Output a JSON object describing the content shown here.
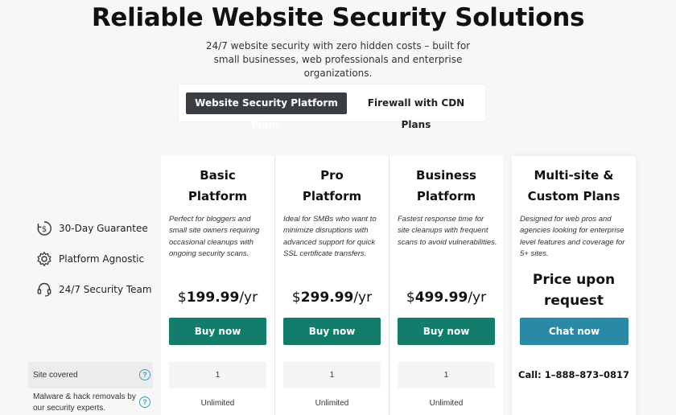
{
  "header": {
    "title": "Reliable Website Security Solutions",
    "subtitle": "24/7 website security with zero hidden costs – built for small businesses, web professionals and enterprise organizations."
  },
  "tabs": [
    {
      "label": "Website Security Platform Plans",
      "active": true
    },
    {
      "label": "Firewall with CDN Plans",
      "active": false
    }
  ],
  "features": [
    {
      "icon": "dollar-refresh-icon",
      "label": "30-Day Guarantee"
    },
    {
      "icon": "gear-icon",
      "label": "Platform Agnostic"
    },
    {
      "icon": "headset-icon",
      "label": "24/7 Security Team"
    }
  ],
  "plans": [
    {
      "name_line1": "Basic",
      "name_line2": "Platform",
      "description": "Perfect for bloggers and small site owners requiring occasional cleanups with ongoing security scans.",
      "price_currency": "$",
      "price_amount": "199.99",
      "price_period": "/yr",
      "button_label": "Buy now",
      "sites_covered": "1",
      "malware_removals": "Unlimited"
    },
    {
      "name_line1": "Pro",
      "name_line2": "Platform",
      "description": "Ideal for SMBs who want to minimize disruptions with advanced support for quick SSL certificate transfers.",
      "price_currency": "$",
      "price_amount": "299.99",
      "price_period": "/yr",
      "button_label": "Buy now",
      "sites_covered": "1",
      "malware_removals": "Unlimited"
    },
    {
      "name_line1": "Business",
      "name_line2": "Platform",
      "description": "Fastest response time for site cleanups with frequent scans to avoid vulnerabilities.",
      "price_currency": "$",
      "price_amount": "499.99",
      "price_period": "/yr",
      "button_label": "Buy now",
      "sites_covered": "1",
      "malware_removals": "Unlimited"
    },
    {
      "name_line1": "Multi-site &",
      "name_line2": "Custom Plans",
      "description": "Designed for web pros and agencies looking for enterprise level features and coverage for 5+ sites.",
      "price_line1": "Price upon",
      "price_line2": "request",
      "button_label": "Chat now",
      "phone": "Call: 1–888–873–0817"
    }
  ],
  "rows": [
    {
      "label": "Site covered",
      "help": "?"
    },
    {
      "label_line1": "Malware & hack removals by",
      "label_line2": "our security experts.",
      "help": "?"
    }
  ],
  "colors": {
    "buy_button": "#137d6c",
    "chat_button": "#2a8aa6",
    "active_tab": "#3a3e43",
    "help_icon": "#3a9bc4"
  }
}
